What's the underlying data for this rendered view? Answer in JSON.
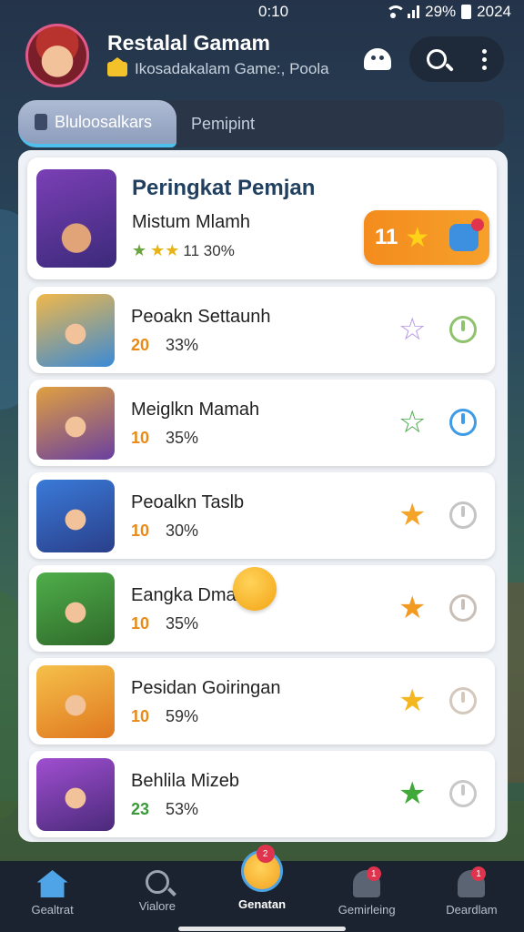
{
  "status_bar": {
    "time": "0:10",
    "battery_text": "29%",
    "year_text": "2024"
  },
  "header": {
    "title": "Restalal Gamam",
    "subtitle": "Ikosadakalam Game:, Poola"
  },
  "tabs": [
    {
      "label": "Bluloosalkars",
      "active": true
    },
    {
      "label": "Pemipint",
      "active": false
    }
  ],
  "featured": {
    "title": "Peringkat Pemjan",
    "player": "Mistum Mlamh",
    "rating": "11 30%",
    "badge_count": "11"
  },
  "players": [
    {
      "name": "Peoakn Settaunh",
      "score": "20",
      "percent": "33%",
      "star_color": "#b796e6",
      "star_filled": false,
      "power_color": "#8fc26d"
    },
    {
      "name": "Meiglkn Mamah",
      "score": "10",
      "percent": "35%",
      "star_color": "#4aa84a",
      "star_filled": false,
      "power_color": "#3f9be6"
    },
    {
      "name": "Peoalkn Taslb",
      "score": "10",
      "percent": "30%",
      "star_color": "#f5a42a",
      "star_filled": true,
      "power_color": "#c4c4c4"
    },
    {
      "name": "Eangka Dmalr",
      "score": "10",
      "percent": "35%",
      "star_color": "#f39a22",
      "star_filled": true,
      "power_color": "#c8c0b8"
    },
    {
      "name": "Pesidan Goiringan",
      "score": "10",
      "percent": "59%",
      "star_color": "#f5b720",
      "star_filled": true,
      "power_color": "#d4c8bc"
    },
    {
      "name": "Behlila Mizeb",
      "score": "23",
      "percent": "53%",
      "star_color": "#41a83a",
      "star_filled": true,
      "power_color": "#c8c8c8"
    }
  ],
  "bottom_nav": [
    {
      "label": "Gealtrat",
      "icon": "home-icon",
      "active": false
    },
    {
      "label": "Vialore",
      "icon": "search-icon",
      "active": false
    },
    {
      "label": "Genatan",
      "icon": "face-icon",
      "active": true,
      "badge": "2"
    },
    {
      "label": "Gemirleing",
      "icon": "person-icon",
      "active": false,
      "badge": "1"
    },
    {
      "label": "Deardlam",
      "icon": "person-icon",
      "active": false,
      "badge": "1"
    }
  ]
}
